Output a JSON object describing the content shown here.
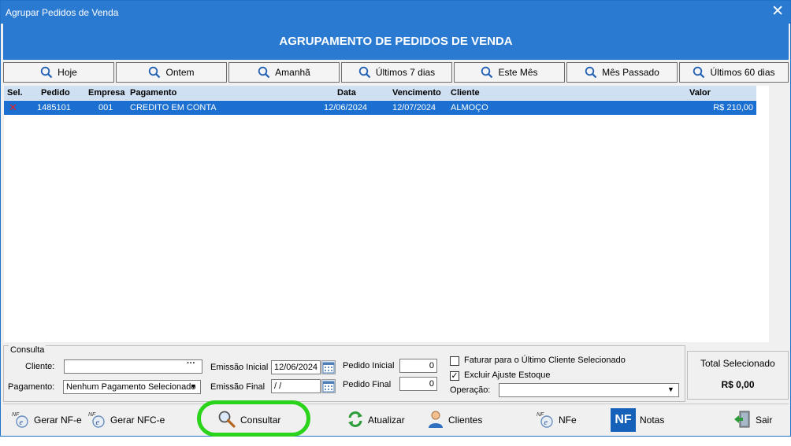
{
  "window": {
    "title": "Agrupar Pedidos de Venda",
    "close_glyph": "✕"
  },
  "banner": "AGRUPAMENTO DE PEDIDOS DE VENDA",
  "quick_filters": [
    "Hoje",
    "Ontem",
    "Amanhã",
    "Últimos 7 dias",
    "Este Mês",
    "Mês Passado",
    "Últimos 60 dias"
  ],
  "grid": {
    "columns": [
      "Sel.",
      "Pedido",
      "Empresa",
      "Pagamento",
      "Data",
      "Vencimento",
      "Cliente",
      "Valor"
    ],
    "rows": [
      {
        "sel": "✕",
        "pedido": "1485101",
        "empresa": "001",
        "pagamento": "CREDITO EM CONTA",
        "data": "12/06/2024",
        "vencimento": "12/07/2024",
        "cliente": "ALMOÇO",
        "valor": "R$ 210,00"
      }
    ]
  },
  "consulta": {
    "legend": "Consulta",
    "cliente_label": "Cliente:",
    "cliente_value": "",
    "lookup_glyph": "···",
    "pagamento_label": "Pagamento:",
    "pagamento_value": "Nenhum Pagamento Selecionado",
    "emissao_inicial_label": "Emissão Inicial",
    "emissao_inicial_value": "12/06/2024",
    "emissao_final_label": "Emissão Final",
    "emissao_final_value": " / /",
    "pedido_inicial_label": "Pedido Inicial",
    "pedido_inicial_value": "0",
    "pedido_final_label": "Pedido Final",
    "pedido_final_value": "0",
    "faturar_label": "Faturar para o Último Cliente Selecionado",
    "faturar_checked": false,
    "excluir_label": "Excluir Ajuste Estoque",
    "excluir_checked": true,
    "check_glyph": "✓",
    "operacao_label": "Operação:",
    "operacao_value": ""
  },
  "total": {
    "label": "Total Selecionado",
    "value": "R$ 0,00"
  },
  "toolbar": {
    "gerar_nfe": "Gerar NF-e",
    "gerar_nfce": "Gerar NFC-e",
    "consultar": "Consultar",
    "atualizar": "Atualizar",
    "clientes": "Clientes",
    "nfe": "NFe",
    "notas_badge": "NF",
    "notas": "Notas",
    "sair": "Sair"
  },
  "icons": {
    "quick_filter": "search-icon",
    "gerar_nfe": "nfe-icon",
    "consultar": "magnifier-icon",
    "atualizar": "refresh-icon",
    "clientes": "user-icon",
    "notas": "nf-badge-icon",
    "sair": "exit-door-icon"
  },
  "colors": {
    "title_bar": "#2b7ad1",
    "selected_row": "#1a6fd0",
    "header_row": "#cfe0f3",
    "highlight_ring": "#2bd41a",
    "delete_mark": "#e0202a"
  }
}
